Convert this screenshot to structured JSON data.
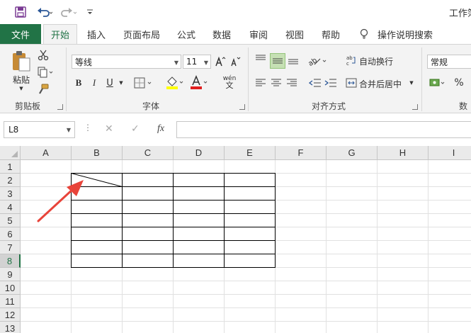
{
  "window": {
    "title": "工作簿",
    "qat": [
      "save-icon",
      "undo-icon",
      "redo-icon",
      "customize-icon"
    ]
  },
  "tabs": {
    "file": "文件",
    "items": [
      "开始",
      "插入",
      "页面布局",
      "公式",
      "数据",
      "审阅",
      "视图",
      "帮助"
    ],
    "active": "开始",
    "tell_me": "操作说明搜索"
  },
  "ribbon": {
    "clipboard": {
      "paste": "粘贴",
      "label": "剪贴板"
    },
    "font": {
      "name": "等线",
      "size": "11",
      "bold": "B",
      "italic": "I",
      "underline": "U",
      "label": "字体",
      "phonetic": "wén"
    },
    "alignment": {
      "wrap": "自动换行",
      "merge": "合并后居中",
      "label": "对齐方式"
    },
    "number": {
      "format": "常规",
      "percent": "%",
      "label": "数字"
    }
  },
  "formula_bar": {
    "name_box": "L8",
    "fx": "fx",
    "value": ""
  },
  "sheet": {
    "columns": [
      "A",
      "B",
      "C",
      "D",
      "E",
      "F",
      "G",
      "H",
      "I"
    ],
    "rows": [
      "1",
      "2",
      "3",
      "4",
      "5",
      "6",
      "7",
      "8",
      "9",
      "10",
      "11",
      "12",
      "13"
    ],
    "selected_row": "8",
    "table_range": "B2:E8"
  },
  "colors": {
    "accent": "#217346",
    "arrow": "#e8443a",
    "border": "#000000"
  }
}
